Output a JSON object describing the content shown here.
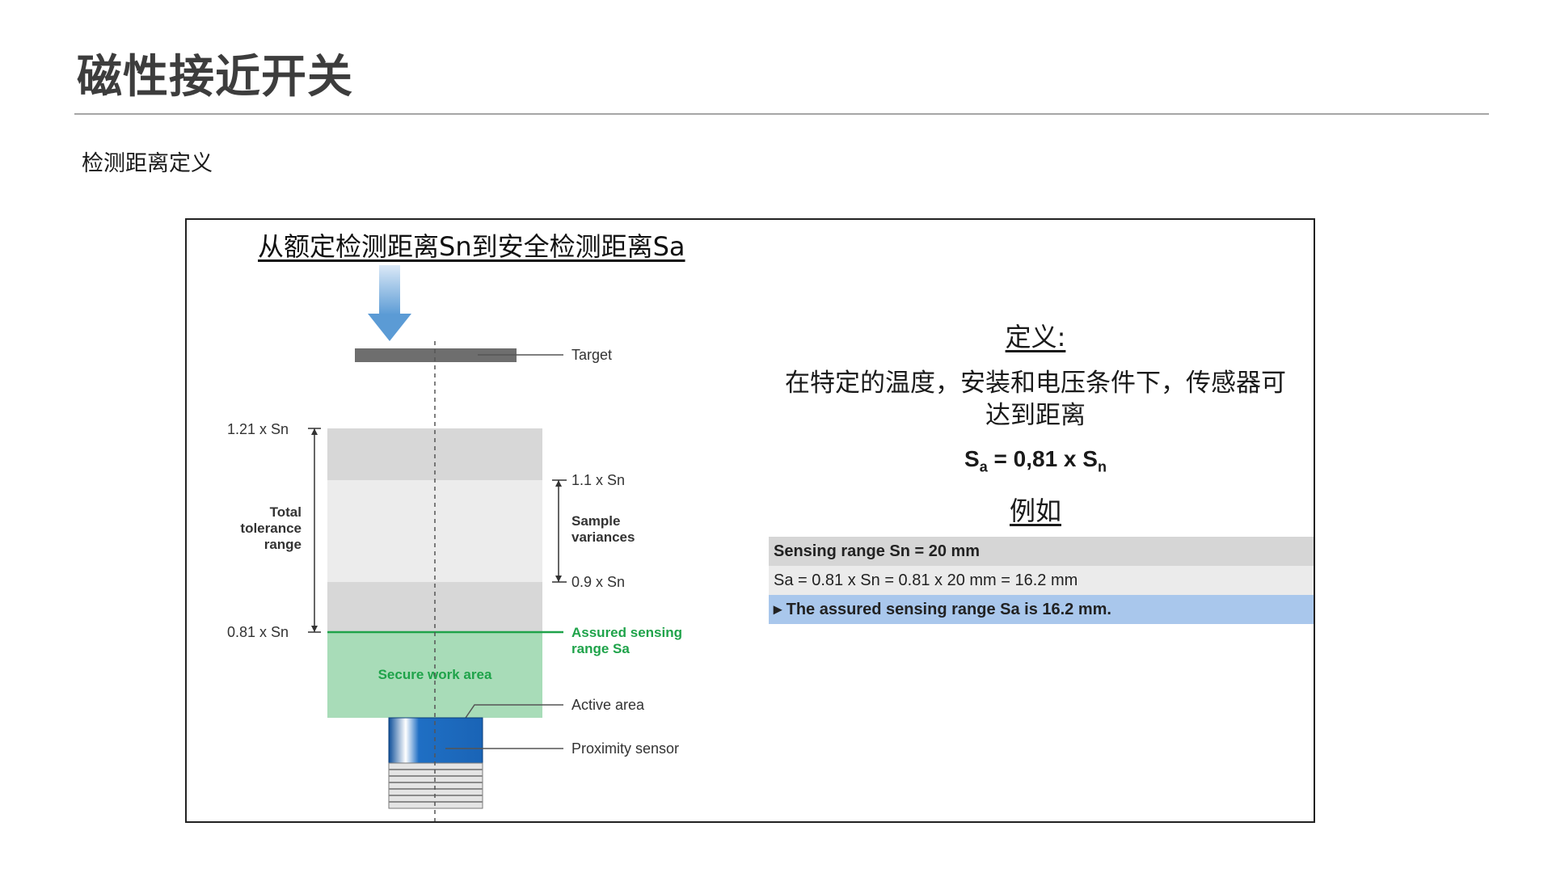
{
  "page": {
    "title": "磁性接近开关",
    "subtitle": "检测距离定义"
  },
  "figure": {
    "heading": "从额定检测距离Sn到安全检测距离Sa",
    "diagram": {
      "target": "Target",
      "sn_121": "1.21 x Sn",
      "sn_11": "1.1 x Sn",
      "sn_09": "0.9 x Sn",
      "sn_081": "0.81 x Sn",
      "total_tolerance_1": "Total",
      "total_tolerance_2": "tolerance",
      "total_tolerance_3": "range",
      "sample_variances_1": "Sample",
      "sample_variances_2": "variances",
      "assured_1": "Assured sensing",
      "assured_2": "range Sa",
      "secure_work_area": "Secure work area",
      "active_area": "Active area",
      "proximity_sensor": "Proximity sensor"
    },
    "definition": {
      "heading": "定义:",
      "body_line1": "在特定的温度，安装和电压条件下，传感器可",
      "body_line2": "达到距离",
      "formula_s1": "S",
      "formula_sub1": "a",
      "formula_mid": " = 0,81 x S",
      "formula_sub2": "n",
      "example_heading": "例如"
    },
    "example_rows": [
      "Sensing range Sn = 20 mm",
      "Sa = 0.81 x Sn = 0.81 x 20 mm = 16.2 mm",
      "▸ The assured sensing range Sa is 16.2 mm."
    ]
  },
  "colors": {
    "arrow": "#5b9bd5",
    "green_line": "#1fa34a",
    "secure_area": "#a8dcb8",
    "highlight_row": "#a9c7ec",
    "sensor_blue": "#1f6fc4"
  }
}
